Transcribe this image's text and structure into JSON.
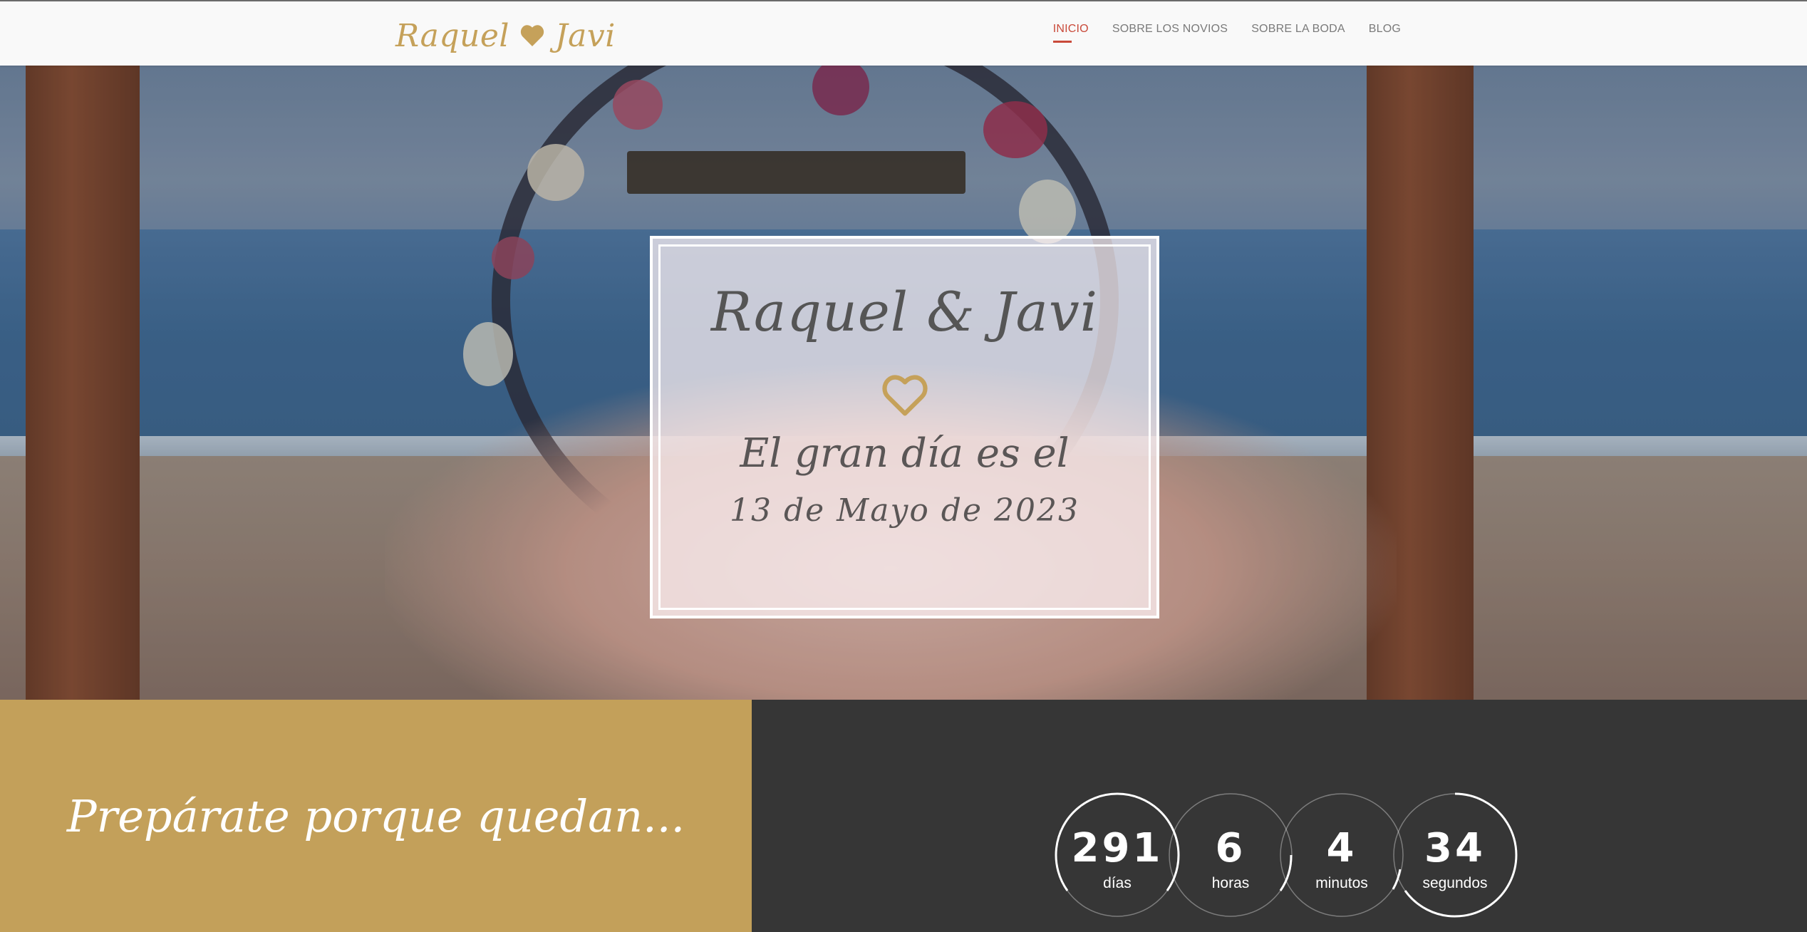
{
  "nav": {
    "brand_left": "Raquel",
    "brand_right": "Javi",
    "items": [
      {
        "label": "INICIO"
      },
      {
        "label": "SOBRE LOS NOVIOS"
      },
      {
        "label": "SOBRE LA BODA"
      },
      {
        "label": "BLOG"
      }
    ],
    "active_index": 0
  },
  "hero": {
    "title": "Raquel & Javi",
    "subtitle": "El gran día es el",
    "date": "13 de Mayo de 2023"
  },
  "countdown": {
    "intro": "Prepárate porque quedan...",
    "units": [
      {
        "value": "291",
        "label": "días"
      },
      {
        "value": "6",
        "label": "horas"
      },
      {
        "value": "4",
        "label": "minutos"
      },
      {
        "value": "34",
        "label": "segundos"
      }
    ]
  },
  "colors": {
    "gold": "#c3a05a",
    "dark": "#363636",
    "active_link": "#c94a3a"
  },
  "icons": {
    "brand_heart": "heart-filled",
    "card_heart": "heart-outline"
  }
}
